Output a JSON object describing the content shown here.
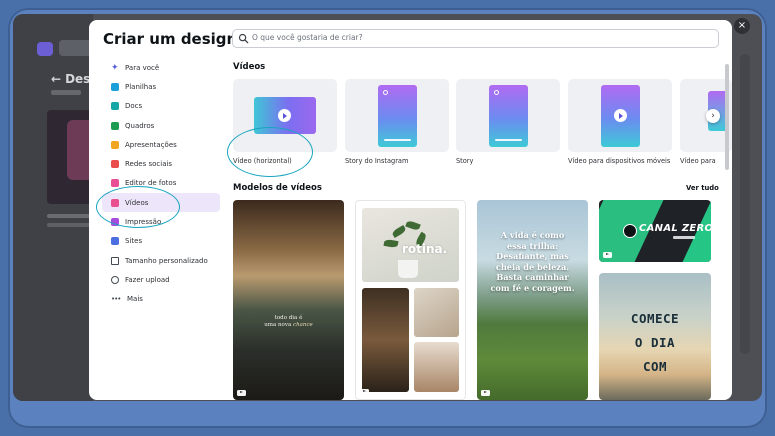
{
  "modal": {
    "title": "Criar um design",
    "search_placeholder": "O que você gostaria de criar?",
    "close_label": "×"
  },
  "nav": {
    "items": [
      {
        "label": "Para você",
        "icon": "sparkle-icon",
        "color": "#5b5fe0"
      },
      {
        "label": "Planilhas",
        "icon": "sheet-icon",
        "color": "#1a9fd9"
      },
      {
        "label": "Docs",
        "icon": "doc-icon",
        "color": "#15a6a6"
      },
      {
        "label": "Quadros",
        "icon": "whiteboard-icon",
        "color": "#1e9b53"
      },
      {
        "label": "Apresentações",
        "icon": "presentation-icon",
        "color": "#f0a620"
      },
      {
        "label": "Redes sociais",
        "icon": "heart-icon",
        "color": "#ea4d4d"
      },
      {
        "label": "Editor de fotos",
        "icon": "photo-icon",
        "color": "#e94d95"
      },
      {
        "label": "Vídeos",
        "icon": "video-icon",
        "color": "#ea4f8f"
      },
      {
        "label": "Impressão",
        "icon": "print-icon",
        "color": "#a54bde"
      },
      {
        "label": "Sites",
        "icon": "website-icon",
        "color": "#4b6fe0"
      },
      {
        "label": "Tamanho personalizado",
        "icon": "resize-icon",
        "color": "#444a52"
      },
      {
        "label": "Fazer upload",
        "icon": "upload-cloud-icon",
        "color": "#444a52"
      },
      {
        "label": "Mais",
        "icon": "more-dots-icon",
        "color": "#444a52"
      }
    ],
    "active_index": 7
  },
  "videos": {
    "section_title": "Vídeos",
    "formats": [
      {
        "label": "Vídeo (horizontal)"
      },
      {
        "label": "Story do Instagram"
      },
      {
        "label": "Story"
      },
      {
        "label": "Vídeo para dispositivos móveis"
      },
      {
        "label": "Vídeo para"
      }
    ]
  },
  "templates": {
    "section_title": "Modelos de vídeos",
    "see_all": "Ver tudo",
    "t1_lines": [
      "todo dia é",
      "uma nova"
    ],
    "t1_script": "chance",
    "t2_word": "rotina.",
    "t3_lines": [
      "A vida é como",
      "essa trilha:",
      "Desafiante, mas",
      "cheia de beleza.",
      "Basta caminhar",
      "com fé e coragem."
    ],
    "t4_text": "CANAL ZERO",
    "t5_lines": [
      "COMECE",
      "O DIA",
      "COM"
    ]
  },
  "background": {
    "title": "Designs"
  }
}
